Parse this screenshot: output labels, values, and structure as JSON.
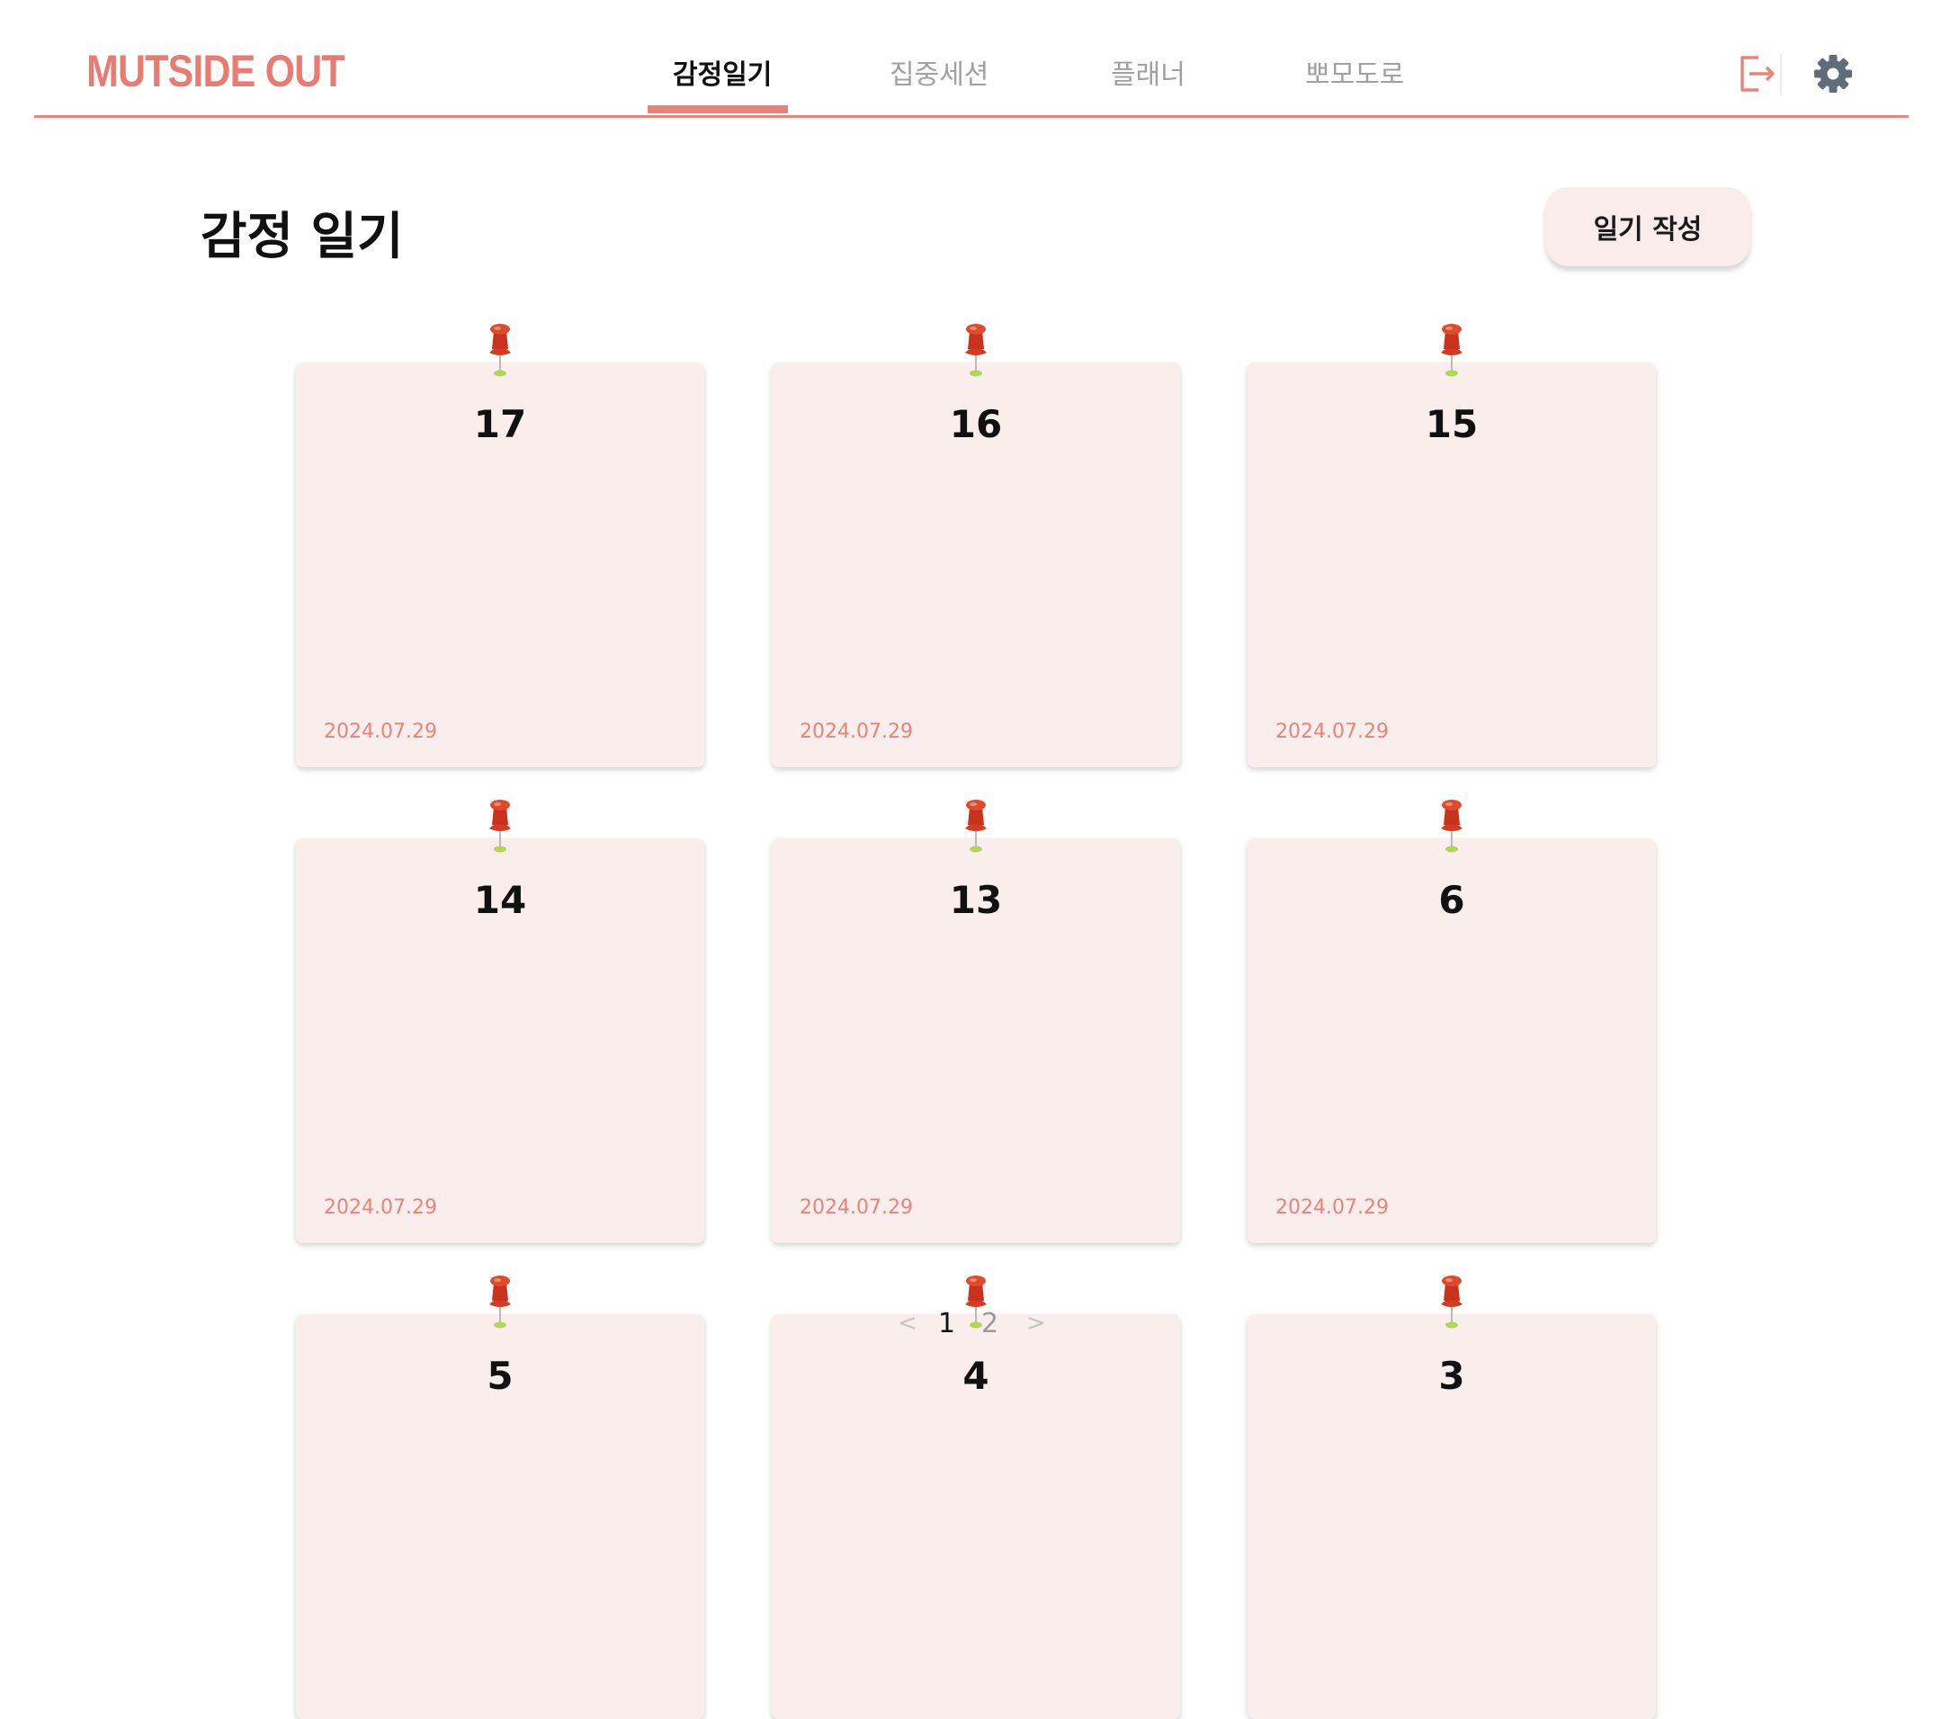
{
  "app": {
    "logo_text": "MUTSIDE OUT"
  },
  "nav": {
    "items": [
      {
        "label": "감정일기",
        "active": true
      },
      {
        "label": "집중세션",
        "active": false
      },
      {
        "label": "플래너",
        "active": false
      },
      {
        "label": "뽀모도로",
        "active": false
      }
    ],
    "icons": {
      "logout": "logout-icon",
      "settings": "gear-icon"
    }
  },
  "page": {
    "title": "감정 일기",
    "write_button_label": "일기 작성"
  },
  "diaries": [
    {
      "title": "17",
      "date": "2024.07.29"
    },
    {
      "title": "16",
      "date": "2024.07.29"
    },
    {
      "title": "15",
      "date": "2024.07.29"
    },
    {
      "title": "14",
      "date": "2024.07.29"
    },
    {
      "title": "13",
      "date": "2024.07.29"
    },
    {
      "title": "6",
      "date": "2024.07.29"
    },
    {
      "title": "5",
      "date": ""
    },
    {
      "title": "4",
      "date": ""
    },
    {
      "title": "3",
      "date": ""
    }
  ],
  "pagination": {
    "prev": "<",
    "pages": [
      "1",
      "2"
    ],
    "current": "1",
    "next": ">"
  },
  "colors": {
    "accent": "#e8837a",
    "card_background": "#faeeec",
    "button_background": "#faecea",
    "gear": "#5f6d78"
  }
}
